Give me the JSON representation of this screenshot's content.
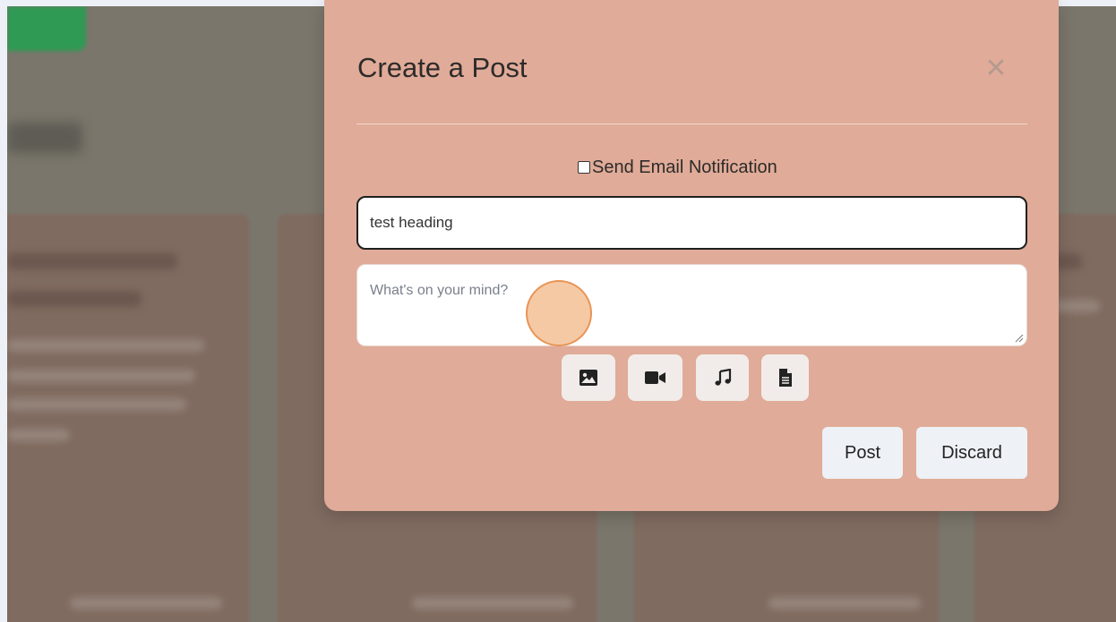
{
  "modal": {
    "title": "Create a Post",
    "close_icon": "close-icon",
    "send_email_label": "Send Email Notification",
    "send_email_checked": false,
    "heading_value": "test heading",
    "body_placeholder": "What's on your mind?",
    "body_value": "",
    "attachments": [
      {
        "name": "image-icon"
      },
      {
        "name": "video-icon"
      },
      {
        "name": "music-icon"
      },
      {
        "name": "document-icon"
      }
    ],
    "post_label": "Post",
    "discard_label": "Discard"
  },
  "colors": {
    "modal_bg": "#e0ab98",
    "overlay": "#7a766b",
    "button_bg": "#eef1f6",
    "click_indicator": "#f0a86e"
  }
}
